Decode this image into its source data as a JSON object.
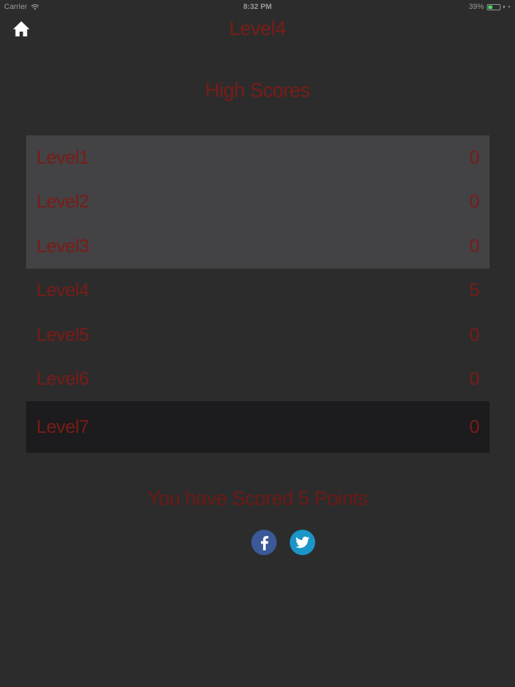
{
  "status_bar": {
    "carrier": "Carrier",
    "time": "8:32 PM",
    "battery_text": "39%",
    "battery_level": 0.39
  },
  "nav": {
    "title": "Level4",
    "home_icon": "home-icon"
  },
  "high_scores": {
    "title": "High Scores",
    "rows": [
      {
        "level": "Level1",
        "score": "0",
        "state": "completed"
      },
      {
        "level": "Level2",
        "score": "0",
        "state": "completed"
      },
      {
        "level": "Level3",
        "score": "0",
        "state": "completed"
      },
      {
        "level": "Level4",
        "score": "5",
        "state": "normal"
      },
      {
        "level": "Level5",
        "score": "0",
        "state": "normal"
      },
      {
        "level": "Level6",
        "score": "0",
        "state": "normal"
      },
      {
        "level": "Level7",
        "score": "0",
        "state": "selected"
      }
    ]
  },
  "result": {
    "message": "You have Scored 5 Points"
  },
  "share": {
    "facebook_icon": "facebook-icon",
    "twitter_icon": "twitter-icon"
  },
  "colors": {
    "background": "#2c2c2d",
    "text_accent": "#7a1c17",
    "completed_row": "#434245",
    "selected_row": "#1c1b1d",
    "facebook": "#3b5998",
    "twitter": "#1b95c7"
  }
}
